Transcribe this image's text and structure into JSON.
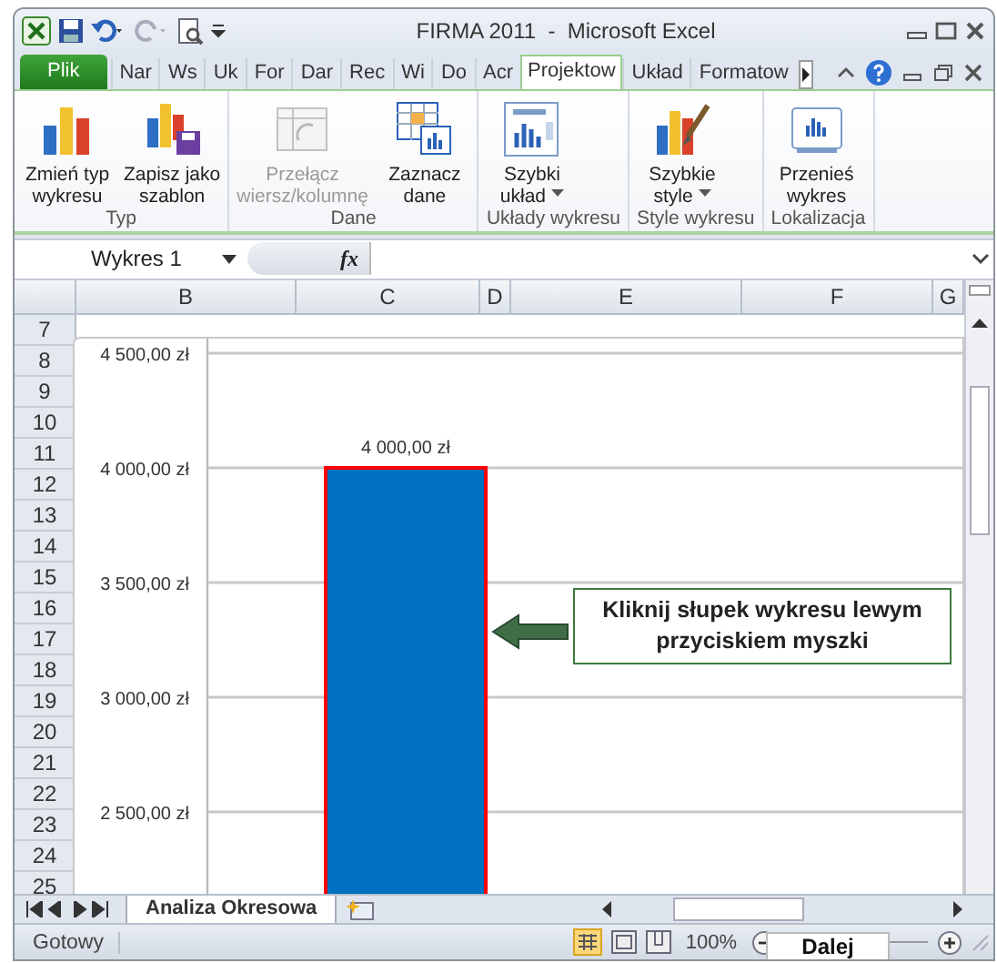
{
  "window": {
    "title": "FIRMA 2011  -  Microsoft Excel"
  },
  "tabs": [
    {
      "label": "Plik",
      "kind": "file",
      "selected": false
    },
    {
      "label": "Nar",
      "kind": "tab",
      "selected": false
    },
    {
      "label": "Ws",
      "kind": "tab",
      "selected": false
    },
    {
      "label": "Uk",
      "kind": "tab",
      "selected": false
    },
    {
      "label": "For",
      "kind": "tab",
      "selected": false
    },
    {
      "label": "Dar",
      "kind": "tab",
      "selected": false
    },
    {
      "label": "Rec",
      "kind": "tab",
      "selected": false
    },
    {
      "label": "Wi",
      "kind": "tab",
      "selected": false
    },
    {
      "label": "Do",
      "kind": "tab",
      "selected": false
    },
    {
      "label": "Acr",
      "kind": "tab",
      "selected": false
    },
    {
      "label": "Projektow",
      "kind": "tab",
      "selected": true
    },
    {
      "label": "Układ",
      "kind": "tab",
      "selected": false
    },
    {
      "label": "Formatow",
      "kind": "tab",
      "selected": false
    }
  ],
  "ribbon": {
    "groups": [
      {
        "label": "Typ",
        "buttons": [
          {
            "label": "Zmień typ\nwykresu",
            "disabled": false,
            "dropdown": false
          },
          {
            "label": "Zapisz jako\nszablon",
            "disabled": false,
            "dropdown": false
          }
        ]
      },
      {
        "label": "Dane",
        "buttons": [
          {
            "label": "Przełącz\nwiersz/kolumnę",
            "disabled": true,
            "dropdown": false
          },
          {
            "label": "Zaznacz\ndane",
            "disabled": false,
            "dropdown": false
          }
        ]
      },
      {
        "label": "Układy wykresu",
        "buttons": [
          {
            "label": "Szybki\nukład",
            "disabled": false,
            "dropdown": true
          }
        ]
      },
      {
        "label": "Style wykresu",
        "buttons": [
          {
            "label": "Szybkie\nstyle",
            "disabled": false,
            "dropdown": true
          }
        ]
      },
      {
        "label": "Lokalizacja",
        "buttons": [
          {
            "label": "Przenieś\nwykres",
            "disabled": false,
            "dropdown": false
          }
        ]
      }
    ]
  },
  "formula_bar": {
    "name_box": "Wykres 1",
    "fx": "fx"
  },
  "sheet": {
    "columns": [
      "B",
      "C",
      "D",
      "E",
      "F",
      "G"
    ],
    "rows": [
      "7",
      "8",
      "9",
      "10",
      "11",
      "12",
      "13",
      "14",
      "15",
      "16",
      "17",
      "18",
      "19",
      "20",
      "21",
      "22",
      "23",
      "24",
      "25"
    ],
    "chart": {
      "chart_data": {
        "type": "bar",
        "values": [
          4000
        ],
        "ylim": [
          2100,
          4500
        ],
        "yticks": [
          {
            "value": 2500,
            "label": "2 500,00 zł"
          },
          {
            "value": 3000,
            "label": "3 000,00 zł"
          },
          {
            "value": 3500,
            "label": "3 500,00 zł"
          },
          {
            "value": 4000,
            "label": "4 000,00 zł"
          },
          {
            "value": 4500,
            "label": "4 500,00 zł"
          }
        ],
        "data_labels": true,
        "grid": true,
        "value_labels": [
          "4 000,00 zł"
        ]
      },
      "callout": "Kliknij słupek wykresu lewym przyciskiem myszki"
    }
  },
  "sheet_tabs": [
    {
      "label": "Analiza Okresowa",
      "selected": true
    }
  ],
  "status_bar": {
    "status": "Gotowy",
    "zoom": "100%",
    "tooltip": "Dalej"
  }
}
